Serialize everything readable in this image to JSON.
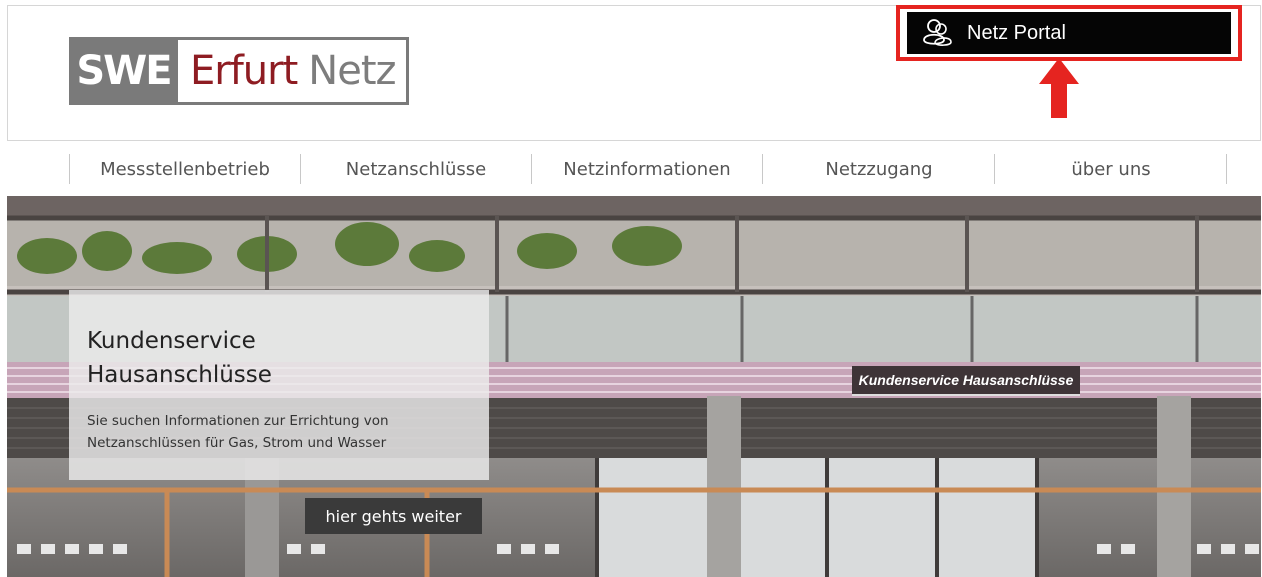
{
  "header": {
    "logo": {
      "part1": "SWE",
      "part2": "Erfurt",
      "part3": "Netz"
    },
    "portal_button": {
      "label": "Netz Portal",
      "icon": "users-icon"
    },
    "annotation": {
      "highlight_color": "#e52420",
      "arrow": "up-arrow-icon"
    }
  },
  "nav": {
    "items": [
      {
        "label": "Messstellenbetrieb"
      },
      {
        "label": "Netzanschlüsse"
      },
      {
        "label": "Netzinformationen"
      },
      {
        "label": "Netzzugang"
      },
      {
        "label": "über uns"
      }
    ]
  },
  "hero": {
    "title_line1": "Kundenservice",
    "title_line2": "Hausanschlüsse",
    "text_line1": "Sie suchen Informationen zur Errichtung von",
    "text_line2": "Netzanschlüssen für Gas, Strom und Wasser",
    "cta_label": "hier gehts weiter",
    "building_sign": "Kundenservice Hausanschlüsse"
  },
  "colors": {
    "brand_red": "#8e1c22",
    "brand_gray": "#7a7a7a",
    "portal_bg": "#050505"
  }
}
